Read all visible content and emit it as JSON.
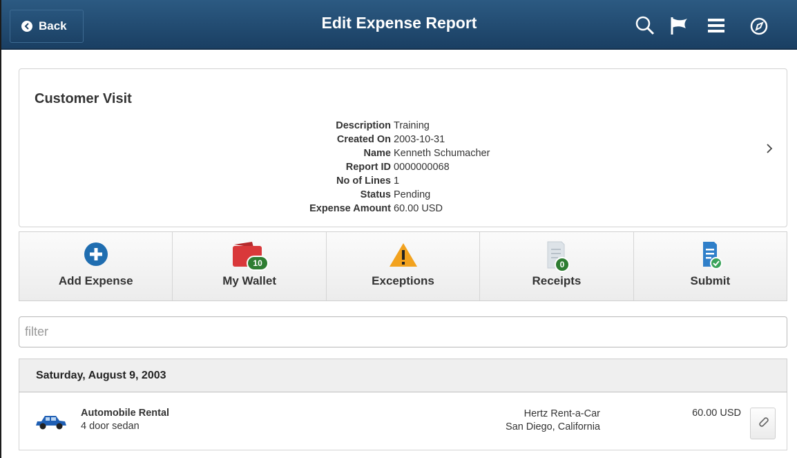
{
  "header": {
    "back_label": "Back",
    "title": "Edit Expense Report",
    "icons": [
      "search-icon",
      "flag-icon",
      "menu-icon",
      "navigator-icon"
    ]
  },
  "report": {
    "name": "Customer Visit",
    "fields": [
      {
        "label": "Description",
        "value": "Training"
      },
      {
        "label": "Created On",
        "value": "2003-10-31"
      },
      {
        "label": "Name",
        "value": "Kenneth Schumacher"
      },
      {
        "label": "Report ID",
        "value": "0000000068"
      },
      {
        "label": "No of Lines",
        "value": "1"
      },
      {
        "label": "Status",
        "value": "Pending"
      },
      {
        "label": "Expense Amount",
        "value": "60.00 USD"
      }
    ]
  },
  "actions": {
    "add_expense": "Add Expense",
    "my_wallet": "My Wallet",
    "wallet_count": "10",
    "exceptions": "Exceptions",
    "receipts": "Receipts",
    "receipts_count": "0",
    "submit": "Submit"
  },
  "filter": {
    "placeholder": "filter",
    "value": ""
  },
  "group": {
    "date": "Saturday, August 9, 2003",
    "lines": [
      {
        "type": "Automobile Rental",
        "description": "4 door sedan",
        "merchant": "Hertz Rent-a-Car",
        "location": "San Diego, California",
        "amount": "60.00 USD"
      }
    ]
  },
  "colors": {
    "header": "#1f4a71",
    "accent_blue": "#1f6db0",
    "wallet_red": "#d9383a",
    "warning": "#f2a21e",
    "badge_green": "#2e7d32"
  }
}
